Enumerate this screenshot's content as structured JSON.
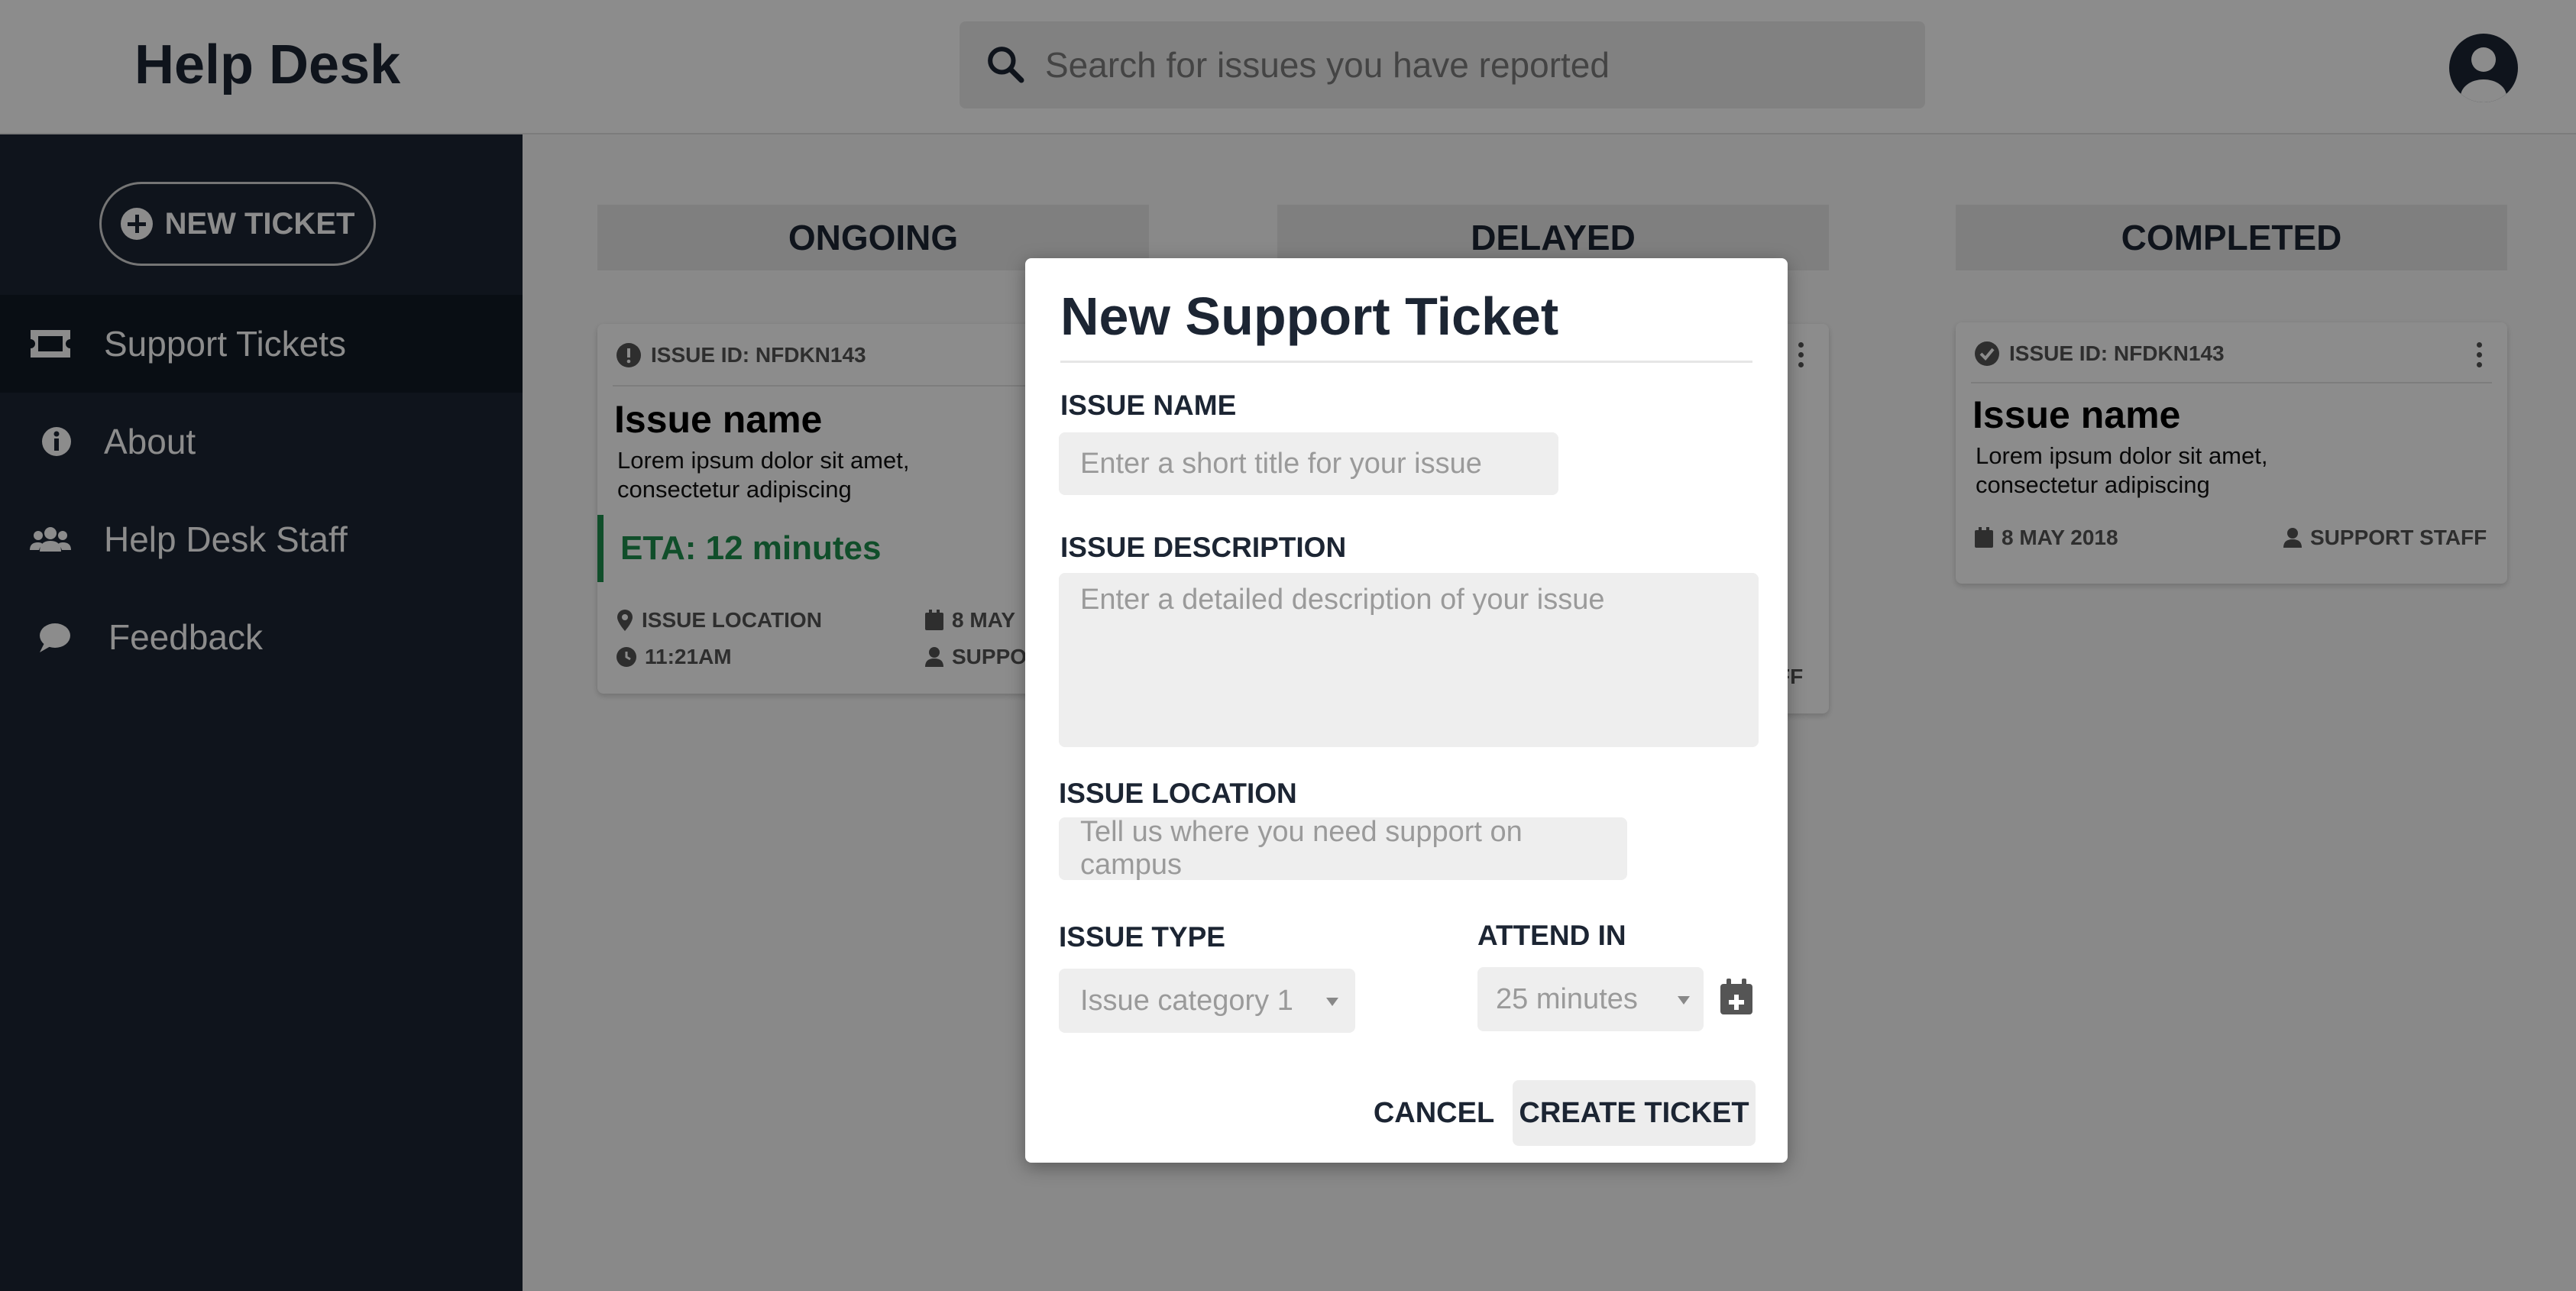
{
  "app": {
    "title": "Help Desk"
  },
  "search": {
    "placeholder": "Search for issues you have reported"
  },
  "sidebar": {
    "new_ticket_label": "NEW TICKET",
    "items": [
      {
        "label": "Support Tickets",
        "icon": "ticket-icon",
        "active": true
      },
      {
        "label": "About",
        "icon": "info-icon",
        "active": false
      },
      {
        "label": "Help Desk Staff",
        "icon": "users-icon",
        "active": false
      },
      {
        "label": "Feedback",
        "icon": "comment-icon",
        "active": false
      }
    ]
  },
  "columns": [
    {
      "label": "ONGOING"
    },
    {
      "label": "DELAYED"
    },
    {
      "label": "COMPLETED"
    }
  ],
  "cards": {
    "ongoing": {
      "issue_id": "ISSUE ID: NFDKN143",
      "name": "Issue name",
      "description": "Lorem ipsum dolor sit amet, consectetur adipiscing",
      "eta": "ETA: 12 minutes",
      "location": "ISSUE LOCATION",
      "time": "11:21AM",
      "date": "8 MAY",
      "staff": "SUPPO"
    },
    "delayed": {
      "staff_fragment": "FF"
    },
    "completed": {
      "issue_id": "ISSUE ID: NFDKN143",
      "name": "Issue name",
      "description": "Lorem ipsum dolor sit amet, consectetur adipiscing",
      "date": "8 MAY 2018",
      "staff": "SUPPORT STAFF"
    }
  },
  "modal": {
    "title": "New Support Ticket",
    "issue_name_label": "ISSUE NAME",
    "issue_name_placeholder": "Enter a short title for your issue",
    "issue_description_label": "ISSUE DESCRIPTION",
    "issue_description_placeholder": "Enter a detailed description of your issue",
    "issue_location_label": "ISSUE LOCATION",
    "issue_location_placeholder": "Tell us where you need support on campus",
    "issue_type_label": "ISSUE TYPE",
    "issue_type_value": "Issue category 1",
    "attend_in_label": "ATTEND IN",
    "attend_in_value": "25 minutes",
    "cancel_label": "CANCEL",
    "create_label": "CREATE TICKET"
  },
  "colors": {
    "sidebar_bg": "#1c2533",
    "eta_green": "#1e8f4e",
    "overlay": "rgba(0,0,0,0.45)"
  }
}
